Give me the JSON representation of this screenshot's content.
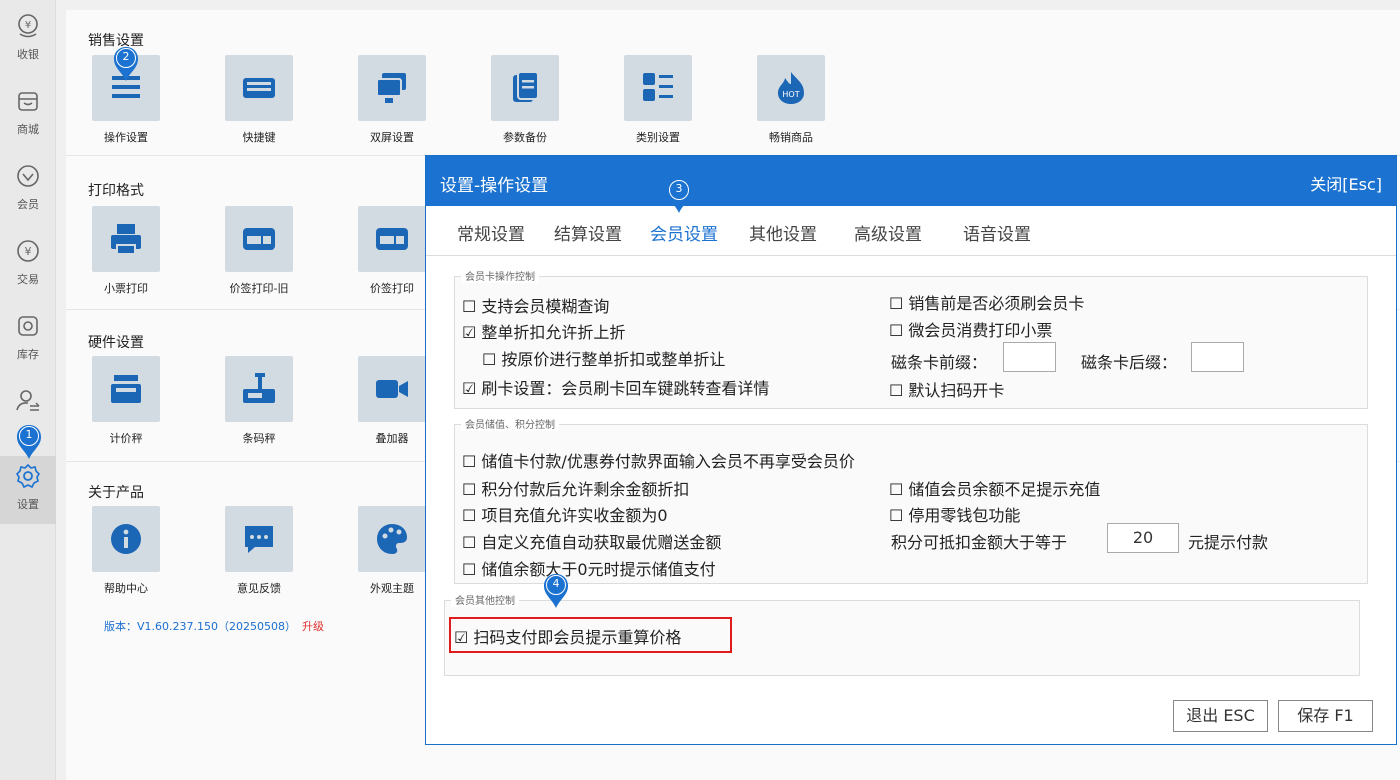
{
  "sidebar": {
    "items": [
      {
        "label": "收银",
        "icon": "cashier-icon"
      },
      {
        "label": "商城",
        "icon": "store-icon"
      },
      {
        "label": "会员",
        "icon": "diamond-icon"
      },
      {
        "label": "交易",
        "icon": "yuan-icon"
      },
      {
        "label": "库存",
        "icon": "inventory-icon"
      },
      {
        "label": "",
        "icon": "user-switch-icon"
      },
      {
        "label": "设置",
        "icon": "gear-icon"
      }
    ],
    "active_index": 6
  },
  "sections": {
    "sales": {
      "title": "销售设置",
      "tiles": [
        "操作设置",
        "快捷键",
        "双屏设置",
        "参数备份",
        "类别设置",
        "畅销商品"
      ]
    },
    "print": {
      "title": "打印格式",
      "tiles": [
        "小票打印",
        "价签打印-旧",
        "价签打印"
      ]
    },
    "hardware": {
      "title": "硬件设置",
      "tiles": [
        "计价秤",
        "条码秤",
        "叠加器"
      ]
    },
    "about": {
      "title": "关于产品",
      "tiles": [
        "帮助中心",
        "意见反馈",
        "外观主题"
      ]
    }
  },
  "hot_badge": "HOT",
  "version": {
    "text": "版本：V1.60.237.150（20250508）",
    "upgrade": "升级"
  },
  "markers": [
    "1",
    "2",
    "3",
    "4"
  ],
  "dialog": {
    "title": "设置-操作设置",
    "close": "关闭[Esc]",
    "tabs": [
      "常规设置",
      "结算设置",
      "会员设置",
      "其他设置",
      "高级设置",
      "语音设置"
    ],
    "active_tab": 2,
    "card_group": {
      "legend": "会员卡操作控制",
      "left": [
        "☐ 支持会员模糊查询",
        "☑ 整单折扣允许折上折",
        "☐ 按原价进行整单折扣或整单折让",
        "☑ 刷卡设置：会员刷卡回车键跳转查看详情"
      ],
      "right": [
        "☐ 销售前是否必须刷会员卡",
        "☐ 微会员消费打印小票",
        "☐ 默认扫码开卡"
      ],
      "prefix_label": "磁条卡前缀：",
      "prefix_value": "",
      "suffix_label": "磁条卡后缀：",
      "suffix_value": ""
    },
    "stored_group": {
      "legend": "会员储值、积分控制",
      "full": "☐ 储值卡付款/优惠券付款界面输入会员不再享受会员价",
      "left": [
        "☐ 积分付款后允许剩余金额折扣",
        "☐ 项目充值允许实收金额为0",
        "☐ 自定义充值自动获取最优赠送金额",
        "☐ 储值余额大于0元时提示储值支付"
      ],
      "right": [
        "☐ 储值会员余额不足提示充值",
        "☐ 停用零钱包功能"
      ],
      "points_prefix": "积分可抵扣金额大于等于",
      "points_value": "20",
      "points_suffix": "元提示付款"
    },
    "other_group": {
      "legend": "会员其他控制",
      "item": "☑ 扫码支付即会员提示重算价格"
    },
    "exit_button": "退出 ESC",
    "save_button": "保存 F1"
  },
  "colors": {
    "accent": "#1b72d0",
    "tile_bg": "#d3dbe2",
    "tile_icon": "#1c67b5",
    "highlight": "#e01b1b",
    "hot": "#1c67b5"
  }
}
